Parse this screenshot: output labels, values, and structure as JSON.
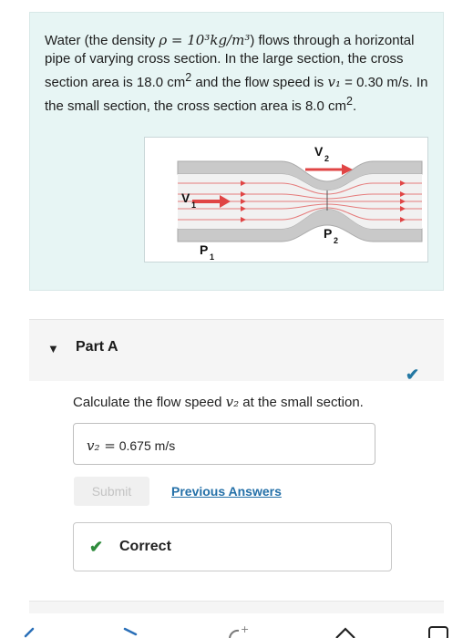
{
  "problem": {
    "seg1": "Water (the density ",
    "density_math": "ρ = 10³kg/m³",
    "seg2": ") flows through a horizontal pipe of varying cross section. In the large section, the cross section area is 18.0 cm",
    "sup1": "2",
    "seg3": " and the flow speed is ",
    "v1_math": "v₁",
    "seg4": " = 0.30 m/s. In the small section, the cross section area is 8.0 cm",
    "sup2": "2",
    "seg5": "."
  },
  "figure": {
    "v1_label": "V",
    "v1_sub": "1",
    "v2_label": "V",
    "v2_sub": "2",
    "p1_label": "P",
    "p1_sub": "1",
    "p2_label": "P",
    "p2_sub": "2"
  },
  "part": {
    "title": "Part A",
    "question_seg1": "Calculate the flow speed ",
    "question_math": "v₂",
    "question_seg2": " at the small section.",
    "answer_var": "v₂ =",
    "answer_value": "0.675",
    "answer_unit": "m/s",
    "submit_label": "Submit",
    "previous_answers_label": "Previous Answers",
    "result_label": "Correct"
  },
  "colors": {
    "accent_link": "#2470a8",
    "correct_green": "#2e8b3c",
    "completed_check": "#2478a3",
    "problem_bg": "#e7f5f4",
    "flow_arrow": "#e04545"
  },
  "icons": {
    "part_toggle": "caret-down-icon",
    "completed": "check-icon",
    "correct": "check-icon",
    "nav": [
      "back-icon",
      "forward-icon",
      "sparkle-icon",
      "home-icon",
      "tabs-icon"
    ]
  }
}
